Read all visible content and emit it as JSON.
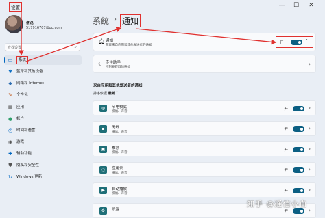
{
  "window": {
    "title": "设置",
    "controls": [
      "—",
      "☐",
      "✕"
    ]
  },
  "user": {
    "name": "谢洛",
    "email": "517916707@qq.com"
  },
  "search": {
    "placeholder": "查找设置"
  },
  "sidebar": {
    "items": [
      {
        "label": "系统",
        "icon": "monitor-icon",
        "glyph": "▭",
        "color": "#0067c0",
        "active": true
      },
      {
        "label": "蓝牙和其他设备",
        "icon": "bluetooth-icon",
        "glyph": "✱",
        "color": "#0067c0"
      },
      {
        "label": "网络和 Internet",
        "icon": "wifi-icon",
        "glyph": "◆",
        "color": "#2b6cb0"
      },
      {
        "label": "个性化",
        "icon": "brush-icon",
        "glyph": "✎",
        "color": "#c05b1f"
      },
      {
        "label": "应用",
        "icon": "apps-icon",
        "glyph": "▦",
        "color": "#555555"
      },
      {
        "label": "帐户",
        "icon": "account-icon",
        "glyph": "●",
        "color": "#2f9e6a"
      },
      {
        "label": "时间和语言",
        "icon": "clock-globe-icon",
        "glyph": "◷",
        "color": "#0067c0"
      },
      {
        "label": "游戏",
        "icon": "gamepad-icon",
        "glyph": "◉",
        "color": "#555555"
      },
      {
        "label": "辅助功能",
        "icon": "accessibility-icon",
        "glyph": "✚",
        "color": "#0067c0"
      },
      {
        "label": "隐私和安全性",
        "icon": "shield-icon",
        "glyph": "⛊",
        "color": "#555555"
      },
      {
        "label": "Windows 更新",
        "icon": "update-icon",
        "glyph": "↻",
        "color": "#0067c0"
      }
    ]
  },
  "breadcrumb": {
    "parent": "系统",
    "separator": "›",
    "current": "通知"
  },
  "notifications": {
    "title": "通知",
    "subtitle": "获取来自应用和其他发送者的通知",
    "toggle_label": "开",
    "on": true
  },
  "focus_assist": {
    "title": "专注助手",
    "subtitle": "控制要获取的通知"
  },
  "section": {
    "title": "来自应用和其他发送者的通知",
    "sort_label": "排序依据",
    "sort_value": "最新"
  },
  "apps": [
    {
      "name": "节电模式",
      "sub": "横幅、声音",
      "toggle_label": "开",
      "on": true,
      "icon": "battery-saver-icon",
      "glyph": "◍"
    },
    {
      "name": "无线",
      "sub": "横幅、声音",
      "toggle_label": "开",
      "on": true,
      "icon": "wireless-icon",
      "glyph": "▪"
    },
    {
      "name": "推荐",
      "sub": "横幅、声音",
      "toggle_label": "开",
      "on": true,
      "icon": "suggested-icon",
      "glyph": "▣"
    },
    {
      "name": "应用云",
      "sub": "横幅、声音",
      "toggle_label": "开",
      "on": true,
      "icon": "app-cloud-icon",
      "glyph": "◌"
    },
    {
      "name": "自动播放",
      "sub": "横幅、声音",
      "toggle_label": "开",
      "on": true,
      "icon": "autoplay-icon",
      "glyph": "▶"
    },
    {
      "name": "设置",
      "sub": "",
      "toggle_label": "开",
      "on": true,
      "icon": "settings-gear-icon",
      "glyph": "⚙"
    }
  ],
  "colors": {
    "accent": "#0067c0",
    "toggle_on": "#0b5f83",
    "annotation": "#e0312f"
  },
  "watermark": "知乎 @通信小白"
}
